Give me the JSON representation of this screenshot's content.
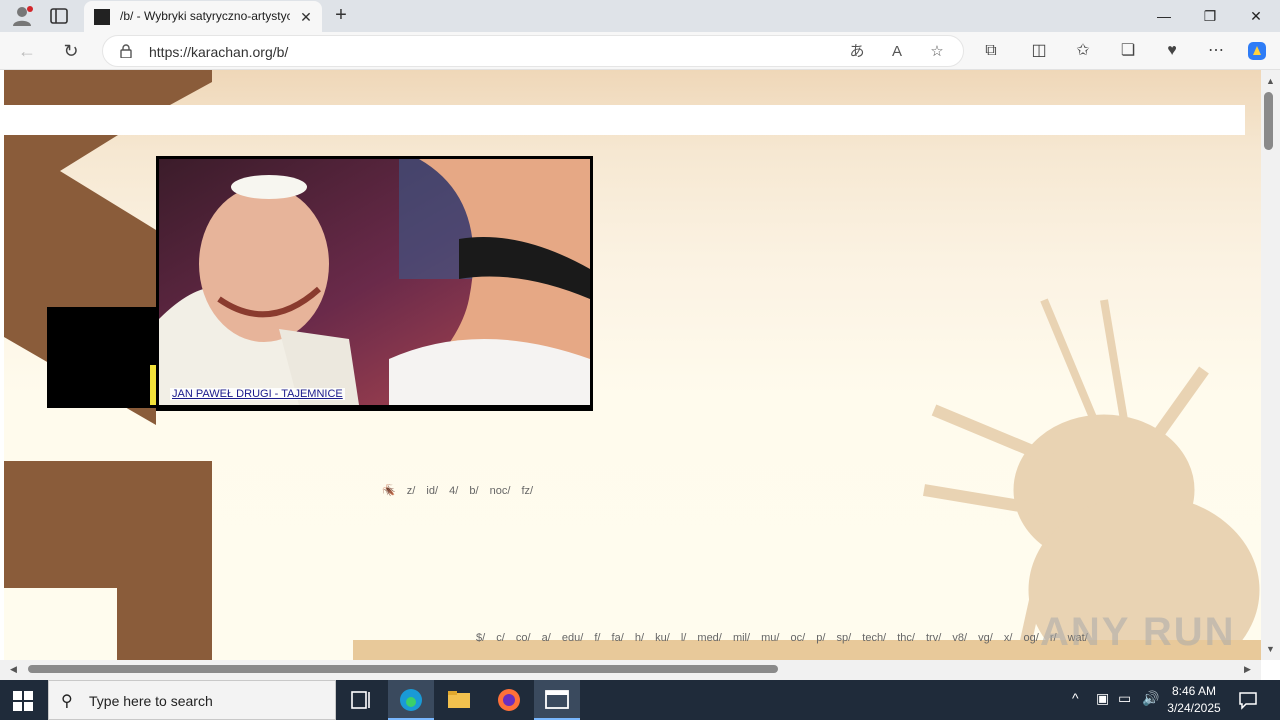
{
  "browser": {
    "tab_title": "/b/ - Wybryki satyryczno-artystyczne",
    "tab_close": "✕",
    "new_tab": "+",
    "url": "https://karachan.org/b/",
    "window_controls": {
      "minimize": "—",
      "restore": "❐",
      "close": "✕"
    }
  },
  "page": {
    "banner_caption": "JAN PAWEŁ DRUGI - TAJEMNICE",
    "board_nav_top": [
      "z/",
      "id/",
      "4/",
      "b/",
      "noc/",
      "fz/"
    ],
    "board_nav_bottom": [
      "$/",
      "c/",
      "co/",
      "a/",
      "edu/",
      "f/",
      "fa/",
      "h/",
      "ku/",
      "l/",
      "med/",
      "mil/",
      "mu/",
      "oc/",
      "p/",
      "sp/",
      "tech/",
      "thc/",
      "trv/",
      "v8/",
      "vg/",
      "x/",
      "og/",
      "r/",
      "wat/"
    ],
    "watermark": "ANY RUN"
  },
  "taskbar": {
    "search_placeholder": "Type here to search",
    "time": "8:46 AM",
    "date": "3/24/2025"
  },
  "colors": {
    "brown": "#8a5c3a",
    "page_bg": "#fffcee",
    "taskbar": "#1f2b3a"
  }
}
